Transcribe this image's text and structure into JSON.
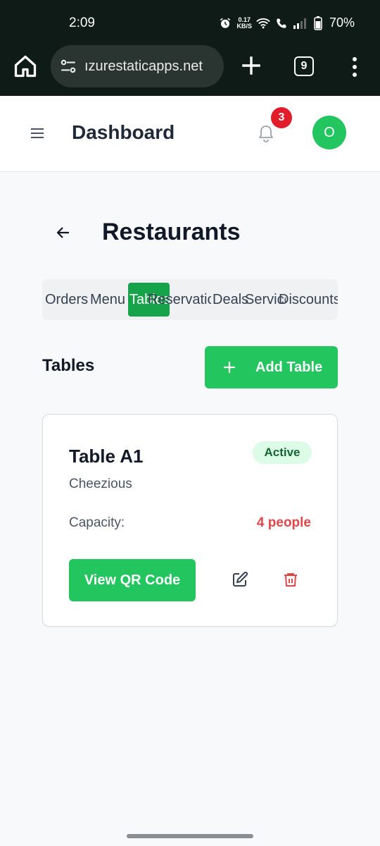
{
  "status_bar": {
    "time": "2:09",
    "net_speed_top": "0.17",
    "net_speed_bottom": "KB/S",
    "battery": "70%"
  },
  "browser": {
    "url": "ızurestaticapps.net",
    "tab_count": "9"
  },
  "header": {
    "title": "Dashboard",
    "notification_count": "3",
    "avatar_initial": "O"
  },
  "section": {
    "title": "Restaurants"
  },
  "tabs": [
    {
      "label": "Orders"
    },
    {
      "label": "Menu"
    },
    {
      "label": "Tables",
      "active": true
    },
    {
      "label": "Reservations"
    },
    {
      "label": "Deals"
    },
    {
      "label": "Services"
    },
    {
      "label": "Discounts"
    }
  ],
  "tables_section": {
    "heading": "Tables",
    "add_button": "Add Table"
  },
  "table_card": {
    "name": "Table A1",
    "status": "Active",
    "restaurant": "Cheezious",
    "capacity_label": "Capacity:",
    "capacity_value": "4 people",
    "qr_button": "View QR Code"
  },
  "colors": {
    "accent_green": "#22c55e",
    "active_tab_green": "#16a34a",
    "badge_red": "#e11d2b",
    "capacity_red": "#e0464a"
  },
  "icons": [
    "home-icon",
    "tune-icon",
    "plus-icon",
    "more-vert-icon",
    "hamburger-icon",
    "bell-icon",
    "back-arrow-icon",
    "edit-icon",
    "trash-icon"
  ]
}
